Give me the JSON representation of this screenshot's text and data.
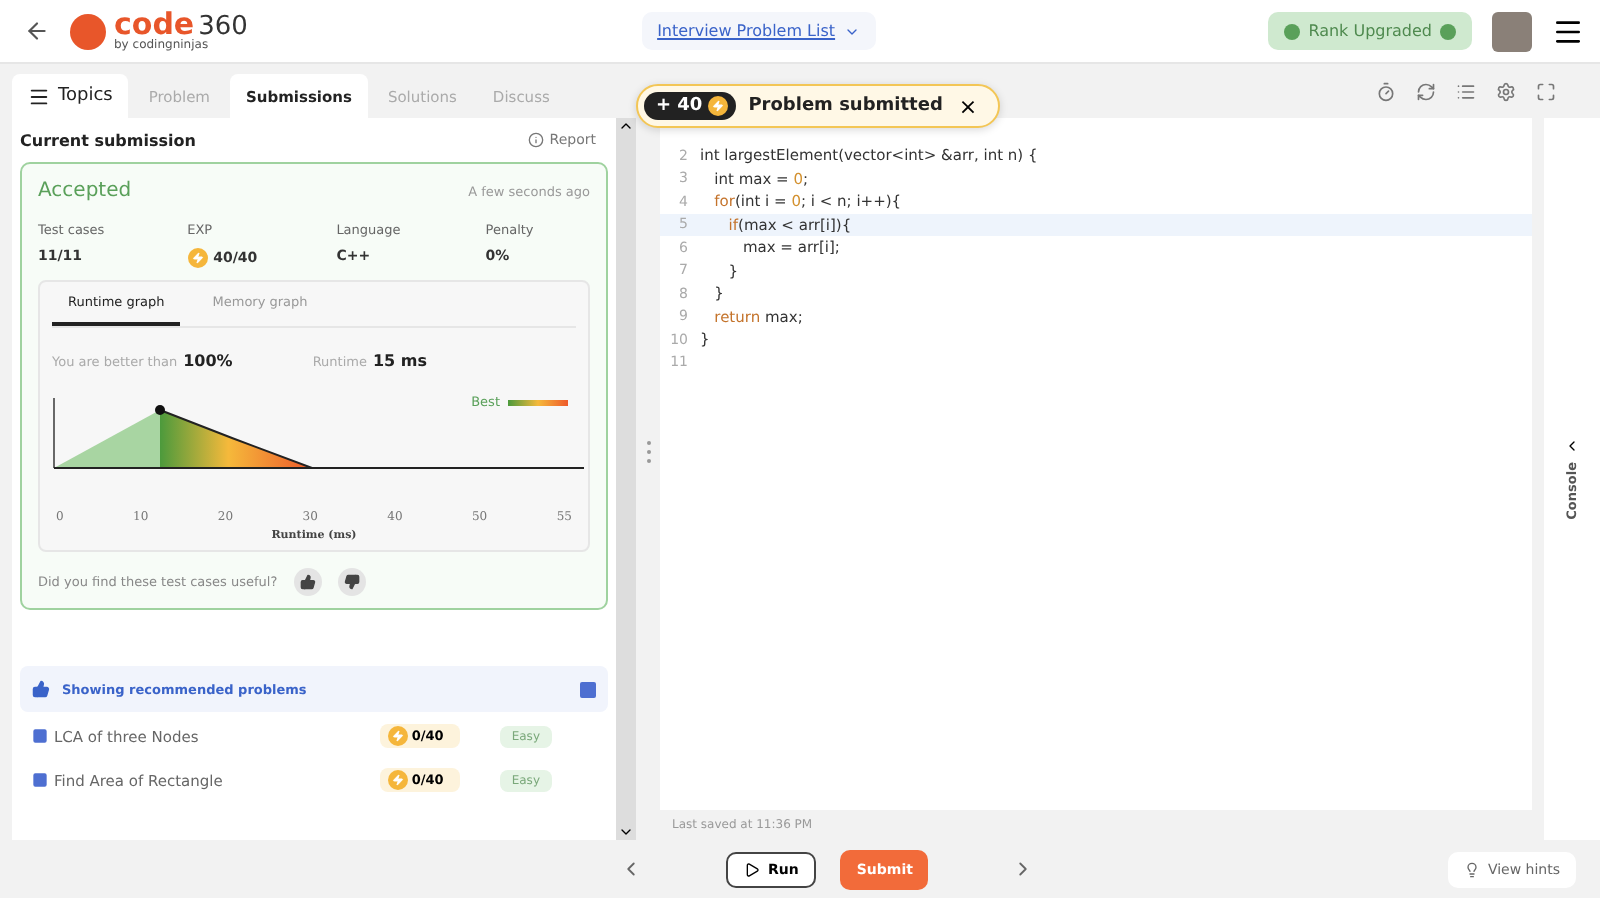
{
  "header": {
    "logo_main": "code",
    "logo_num": "360",
    "logo_sub": "by codingninjas",
    "problem_list": "Interview Problem List",
    "rank_badge": "Rank Upgraded"
  },
  "tabs": [
    {
      "label": "Topics",
      "kind": "topics",
      "selected": false
    },
    {
      "label": "Problem",
      "kind": "tab",
      "selected": false
    },
    {
      "label": "Submissions",
      "kind": "tab",
      "selected": true
    },
    {
      "label": "Solutions",
      "kind": "tab",
      "selected": false
    },
    {
      "label": "Discuss",
      "kind": "tab",
      "selected": false
    }
  ],
  "toast": {
    "points": "+ 40",
    "message": "Problem submitted",
    "close": "×"
  },
  "submission": {
    "title": "Current submission",
    "report": "Report",
    "status": "Accepted",
    "time": "A few seconds ago",
    "stats": [
      {
        "label": "Test cases",
        "value": "11/11",
        "kind": "plain"
      },
      {
        "label": "EXP",
        "value": "40/40",
        "kind": "exp"
      },
      {
        "label": "Language",
        "value": "C++",
        "kind": "plain"
      },
      {
        "label": "Penalty",
        "value": "0%",
        "kind": "plain"
      }
    ],
    "graph_tabs": [
      {
        "label": "Runtime graph",
        "selected": true
      },
      {
        "label": "Memory graph",
        "selected": false
      }
    ],
    "better_label": "You are better than",
    "better_value": "100%",
    "runtime_label": "Runtime",
    "runtime_value": "15 ms",
    "legend": "Best",
    "axis_labels": [
      "0",
      "10",
      "20",
      "30",
      "40",
      "50",
      "55"
    ],
    "xlabel": "Runtime (ms)",
    "feedback": "Did you find these test cases useful?"
  },
  "recommended": {
    "label": "Showing recommended problems",
    "checked": true,
    "items": [
      {
        "name": "LCA of three Nodes",
        "exp": "0/40",
        "difficulty": "Easy"
      },
      {
        "name": "Find Area of Rectangle",
        "exp": "0/40",
        "difficulty": "Easy"
      }
    ]
  },
  "editor": {
    "lines": [
      {
        "n": "2",
        "highlighted": false,
        "tokens": [
          {
            "t": "int largestElement(vector<int> &arr, int n) {",
            "kind": "plain"
          }
        ]
      },
      {
        "n": "3",
        "highlighted": false,
        "tokens": [
          {
            "t": "   int max = ",
            "kind": "plain"
          },
          {
            "t": "0",
            "kind": "num"
          },
          {
            "t": ";",
            "kind": "plain"
          }
        ]
      },
      {
        "n": "4",
        "highlighted": false,
        "tokens": [
          {
            "t": "   for",
            "kind": "kw"
          },
          {
            "t": "(int i = ",
            "kind": "plain"
          },
          {
            "t": "0",
            "kind": "num"
          },
          {
            "t": "; i < n; i++){",
            "kind": "plain"
          }
        ]
      },
      {
        "n": "5",
        "highlighted": true,
        "tokens": [
          {
            "t": "      if",
            "kind": "kw"
          },
          {
            "t": "(max < arr[i]){",
            "kind": "plain"
          }
        ]
      },
      {
        "n": "6",
        "highlighted": false,
        "tokens": [
          {
            "t": "         max = arr[i];",
            "kind": "plain"
          }
        ]
      },
      {
        "n": "7",
        "highlighted": false,
        "tokens": [
          {
            "t": "      }",
            "kind": "plain"
          }
        ]
      },
      {
        "n": "8",
        "highlighted": false,
        "tokens": [
          {
            "t": "   }",
            "kind": "plain"
          }
        ]
      },
      {
        "n": "9",
        "highlighted": false,
        "tokens": [
          {
            "t": "   return",
            "kind": "kw"
          },
          {
            "t": " max;",
            "kind": "plain"
          }
        ]
      },
      {
        "n": "10",
        "highlighted": false,
        "tokens": [
          {
            "t": "}",
            "kind": "plain"
          }
        ]
      },
      {
        "n": "11",
        "highlighted": false
      }
    ],
    "saved": "Last saved at 11:36 PM",
    "console": "Console"
  },
  "footer": {
    "run": "Run",
    "submit": "Submit",
    "hints": "View hints"
  }
}
